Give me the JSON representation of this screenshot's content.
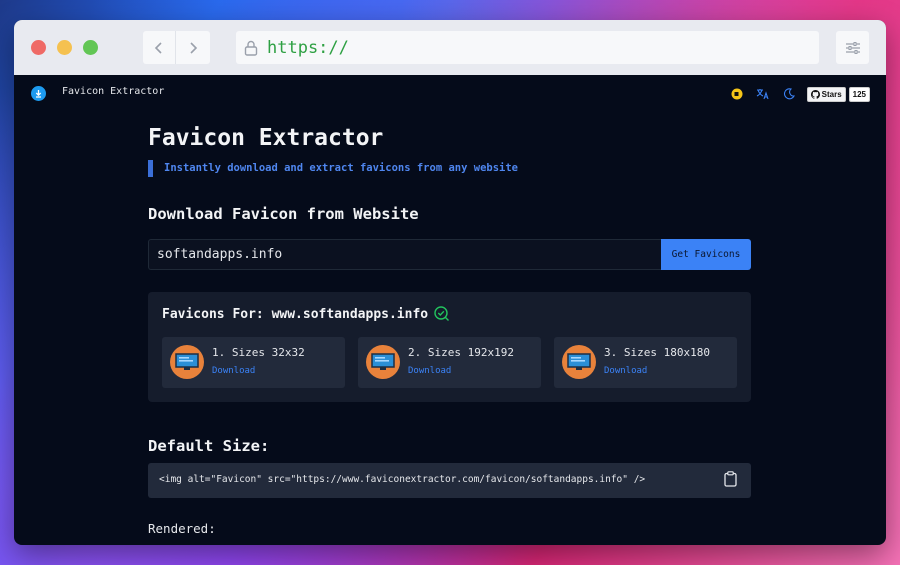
{
  "browser": {
    "url": "https://"
  },
  "nav": {
    "app_name": "Favicon Extractor",
    "github_stars_label": "Stars",
    "github_stars_count": "125"
  },
  "main": {
    "title": "Favicon Extractor",
    "tagline": "Instantly download and extract favicons from any website",
    "download_heading": "Download Favicon from Website",
    "search_value": "softandapps.info",
    "search_button": "Get Favicons",
    "results_title": "Favicons For: www.softandapps.info",
    "favicons": [
      {
        "size_label": "1. Sizes 32x32",
        "download_label": "Download"
      },
      {
        "size_label": "2. Sizes 192x192",
        "download_label": "Download"
      },
      {
        "size_label": "3. Sizes 180x180",
        "download_label": "Download"
      }
    ],
    "default_size_heading": "Default Size:",
    "code_snippet": "<img alt=\"Favicon\" src=\"https://www.faviconextractor.com/favicon/softandapps.info\" />",
    "rendered_label": "Rendered:"
  },
  "colors": {
    "accent": "#3b82f6",
    "favicon_bg": "#e8823b",
    "success": "#22c55e"
  }
}
